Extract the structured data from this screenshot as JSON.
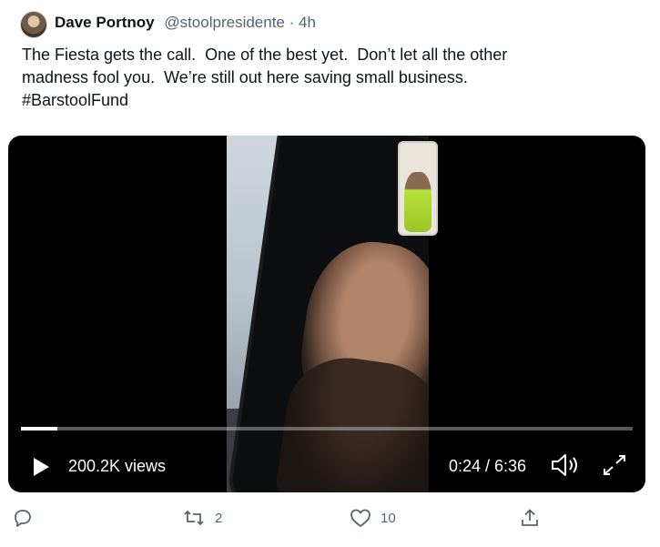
{
  "author": {
    "name": "Dave Portnoy",
    "handle": "@stoolpresidente",
    "separator": "·",
    "time": "4h"
  },
  "tweet": {
    "lines": [
      "The Fiesta gets the call.  One of the best yet.  Don’t let all the other",
      "madness fool you.  We’re still out here saving small business.",
      "#BarstoolFund"
    ]
  },
  "video": {
    "views": "200.2K views",
    "time": "0:24 / 6:36",
    "progress": 0.06,
    "icons": [
      "play-icon",
      "volume-icon",
      "expand-icon"
    ]
  },
  "actions": {
    "reply_count": "",
    "retweet_count": "2",
    "like_count": "10",
    "share_count": ""
  },
  "colors": {
    "text": "#0f1419",
    "secondary": "#536471",
    "video_bg": "#000000"
  }
}
